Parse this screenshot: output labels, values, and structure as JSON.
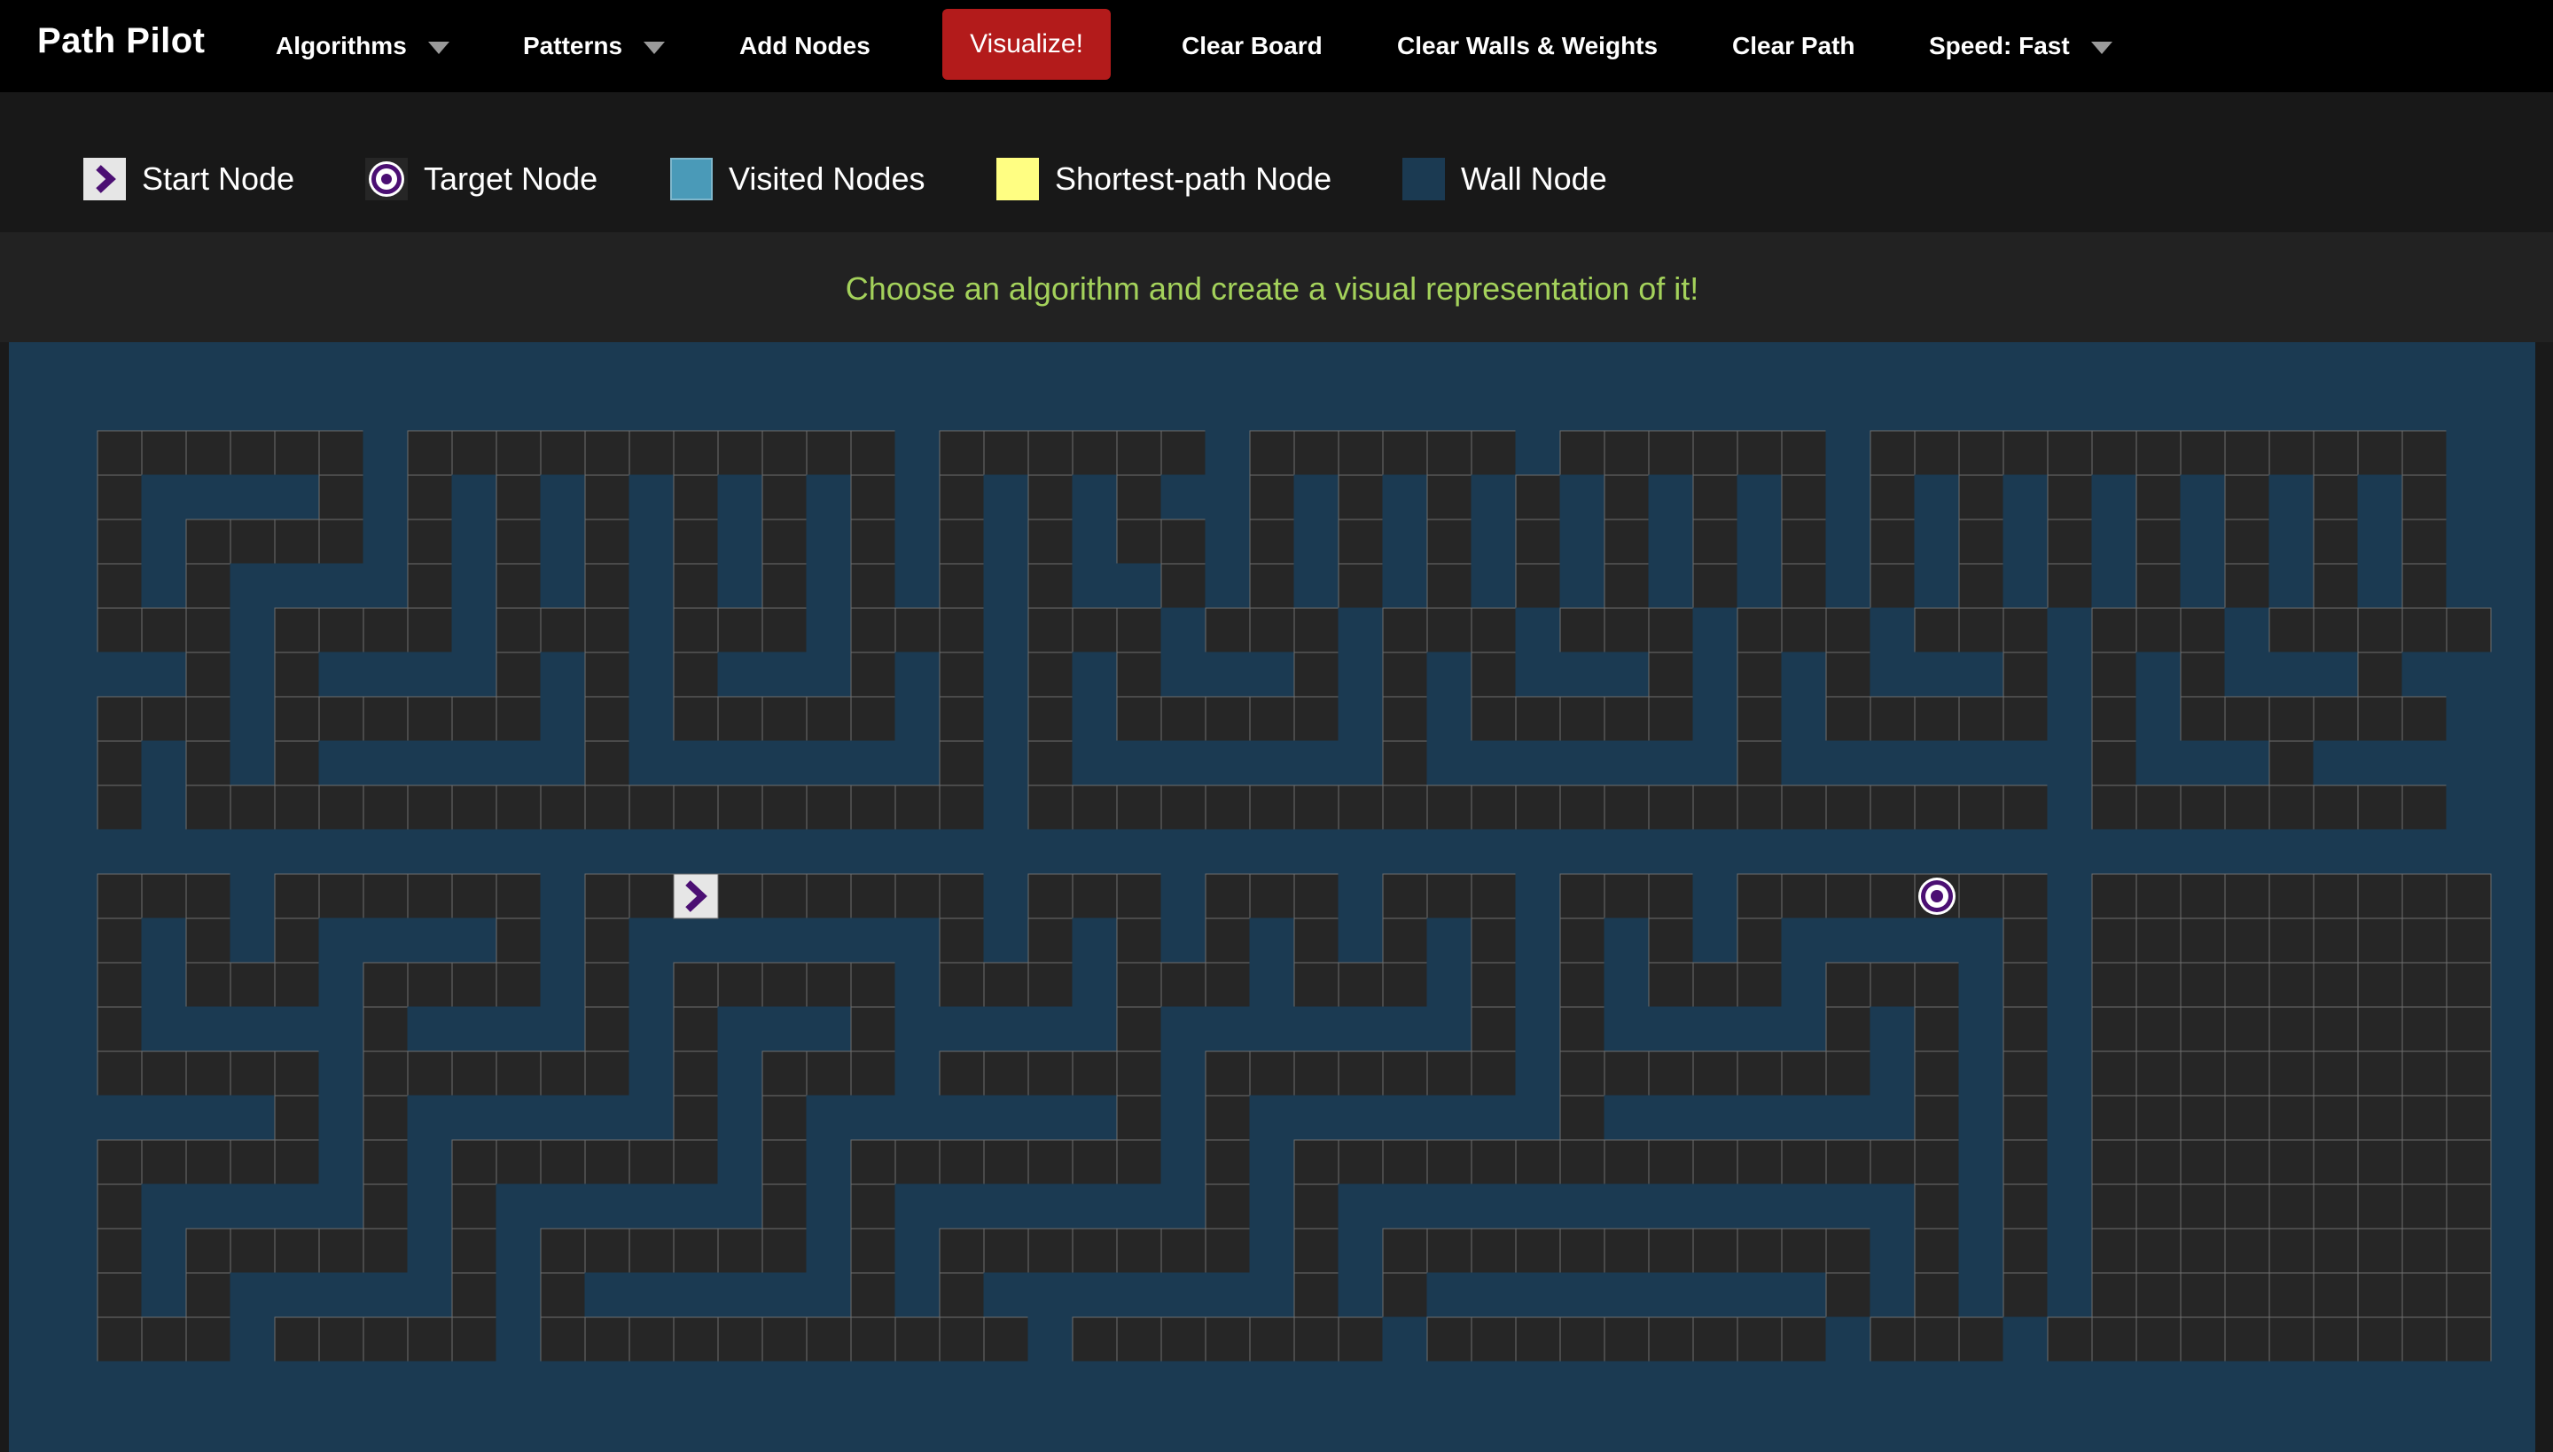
{
  "app": {
    "title": "Path Pilot"
  },
  "nav": {
    "algorithms": "Algorithms",
    "patterns": "Patterns",
    "add_nodes": "Add Nodes",
    "visualize": "Visualize!",
    "clear_board": "Clear Board",
    "clear_walls_weights": "Clear Walls & Weights",
    "clear_path": "Clear Path",
    "speed": "Speed: Fast"
  },
  "legend": {
    "start": "Start Node",
    "target": "Target Node",
    "visited": "Visited Nodes",
    "shortest": "Shortest-path Node",
    "wall": "Wall Node"
  },
  "info": {
    "message": "Choose an algorithm and create a visual representation of it!"
  },
  "colors": {
    "background": "#1a1a1a",
    "navbar": "#000000",
    "visualize_button": "#b31b1b",
    "info_text": "#a4d25b",
    "empty_cell": "#262626",
    "grid_line": "#6e6e6e",
    "wall": "#1b3a52",
    "visited": "#4a9ab8",
    "shortest_path": "#fffe82",
    "start_icon": "#4b0f73",
    "target_icon": "#4b0f73"
  },
  "icons": {
    "start": "chevron-right-icon",
    "target": "bullseye-icon",
    "dropdown": "caret-down-icon"
  },
  "grid": {
    "rows": 23,
    "cols": 55,
    "start": [
      11,
      14
    ],
    "target": [
      11,
      42
    ],
    "cells": [
      "#######################################################",
      "#......#...........#......#......#......#.............#",
      "#.####.#.#.#.#.#.#.#.#.#.##.#.#.#.#.#.#.#.#.#.#.#.#.#.#",
      "#.#....#.#.#.#.#.#.#.#.#..#.#.#.#.#.#.#.#.#.#.#.#.#.#.#",
      "#.#.####.#.#.#.#.#.#.#.##.#.#.#.#.#.#.#.#.#.#.#.#.#.#.#",
      "#...#....#...#...#...#...#...#...#...#...#...#...#.....#",
      "###.#.####.#.#.###.#.#.#.###.#.#.###.#.#.###.#.#.###.##",
      "#...#......#.#.....#.#.#.....#.#.....#.#.....#.#......#",
      "#.#.#.######.#######.#.#######.#######.#######.###.####",
      "#.#..................#.......................#........#",
      "#######################################################",
      "#...#......#.........#...#...#...#...#.......#.........",
      "#.#.#.####.#.#######.#.#.#.#.#.#.#.#.#.#####.#.........",
      "#.#...#....#.#.....#...#...#...#.#.#...#...#.#.........",
      "#.#####.####.#.###.#####.#######.#.#####.#.#.#.........",
      "#.....#......#.#...#.....#.......#.......#.#.#.........",
      "#####.#.######.#.#######.#.#######.#######.#.#.........",
      "#.....#.#......#.#.......#.#...............#.#.........",
      "#.#####.#.######.#.#######.#.#############.#.#.........",
      "#.#.....#.#......#.#.......#.#...........#.#.#.........",
      "#.#.#####.#.######.#.#######.#.#########.#.#.#.........",
      "#...#.....#...........#.......#.........#...#..........",
      "#######################################################"
    ]
  }
}
